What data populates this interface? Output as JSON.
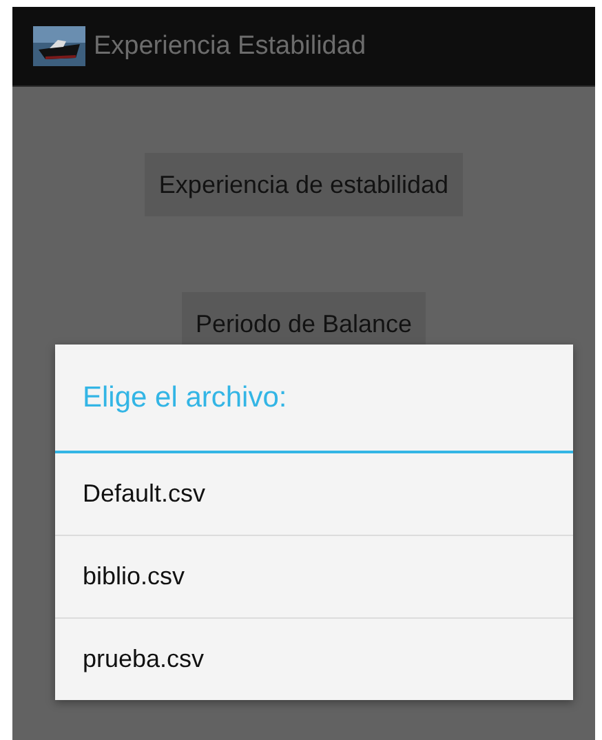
{
  "action_bar": {
    "title": "Experiencia Estabilidad"
  },
  "buttons": [
    "Experiencia de estabilidad",
    "Periodo de Balance"
  ],
  "dialog": {
    "title": "Elige el archivo:",
    "items": [
      {
        "label": "Default.csv"
      },
      {
        "label": "biblio.csv"
      },
      {
        "label": "prueba.csv"
      }
    ]
  }
}
